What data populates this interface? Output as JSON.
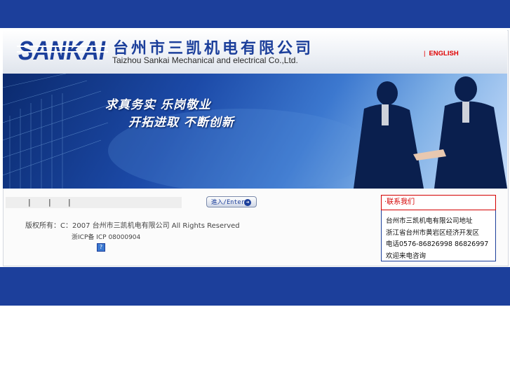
{
  "header": {
    "logo_text": "SANKAI",
    "company_cn": "台州市三凯机电有限公司",
    "company_en": "Taizhou Sankai Mechanical and electrical Co.,Ltd.",
    "lang_separator": "|",
    "lang_link": "ENGLISH"
  },
  "banner": {
    "slogan_line1": "求真务实  乐岗敬业",
    "slogan_line2": "开拓进取  不断创新"
  },
  "nav": {
    "separators": [
      "|",
      "|",
      "|"
    ]
  },
  "enter_button": {
    "label": "進入/Enter",
    "icon": "arrow-right-icon"
  },
  "footer": {
    "copyright": "版权所有：C：2007  台州市三凯机电有限公司 All Rights Reserved",
    "icp": "浙ICP备 ICP 08000904",
    "icp_icon": "question-icon"
  },
  "contact": {
    "title": "·联系我们",
    "lines": [
      "台州市三凯机电有限公司地址",
      "浙江省台州市黄岩区经济开发区",
      "电话0576-86826998 86826997",
      "欢迎来电咨询"
    ]
  },
  "colors": {
    "brand_blue": "#1c3f9b",
    "accent_red": "#d40000"
  }
}
